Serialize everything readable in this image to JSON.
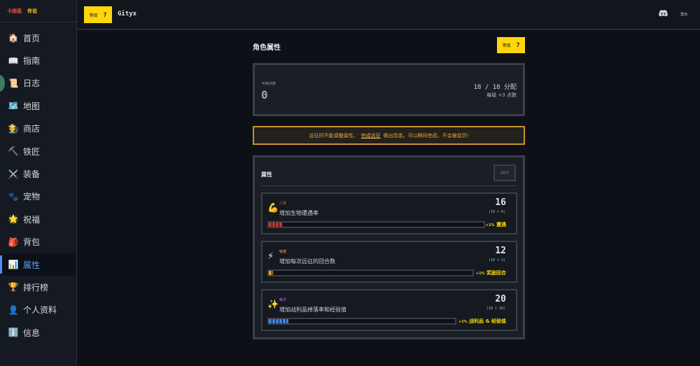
{
  "brand": {
    "name": "卡姆基",
    "tier": "传说"
  },
  "nav": [
    {
      "icon": "🏠",
      "label": "首页"
    },
    {
      "icon": "📖",
      "label": "指南"
    },
    {
      "icon": "📜",
      "label": "日志"
    },
    {
      "icon": "🗺️",
      "label": "地图"
    },
    {
      "icon": "🧑‍🌾",
      "label": "商店"
    },
    {
      "icon": "⛏️",
      "label": "铁匠"
    },
    {
      "icon": "⚔️",
      "label": "装备"
    },
    {
      "icon": "🐾",
      "label": "宠物"
    },
    {
      "icon": "🌟",
      "label": "祝福"
    },
    {
      "icon": "🎒",
      "label": "背包"
    },
    {
      "icon": "📊",
      "label": "属性"
    },
    {
      "icon": "🏆",
      "label": "排行榜"
    },
    {
      "icon": "👤",
      "label": "个人资料"
    },
    {
      "icon": "ℹ️",
      "label": "信息"
    }
  ],
  "topbar": {
    "level_label": "等级",
    "level_value": "7",
    "player_name": "Gityx",
    "logout_label": "登出"
  },
  "page": {
    "title": "角色属性",
    "level_label": "等级",
    "level_value": "7"
  },
  "points": {
    "label": "可用点数",
    "value": "0",
    "allocated": "18 / 18 分配",
    "per_level": "每级 +3 点数"
  },
  "warning": {
    "prefix": "远征时不能调整属性。",
    "link": "完成远征",
    "suffix": "做出改变。可以瞬间完成，不会被惩罚!"
  },
  "attributes": {
    "title": "属性",
    "button_label": "远征中",
    "items": [
      {
        "icon": "💪",
        "name": "力量",
        "name_color": "#e24a3b",
        "description": "增加生物遭遇率",
        "value": "16",
        "breakdown": "(10 + 6)",
        "bonus_pct": "+1%",
        "bonus_text": "遭遇",
        "bar_fill": 0.062,
        "bar_color": "#c0392b"
      },
      {
        "icon": "⚡",
        "name": "敏捷",
        "name_color": "#e9a73b",
        "description": "增加每次远征的回合数",
        "value": "12",
        "breakdown": "(10 + 2)",
        "bonus_pct": "+1%",
        "bonus_text": "奖励回合",
        "bar_fill": 0.021,
        "bar_color": "#e0a020"
      },
      {
        "icon": "✨",
        "name": "精灵",
        "name_color": "#b06ee8",
        "description": "增加战利品掉落率和经验值",
        "value": "20",
        "breakdown": "(10 + 10)",
        "bonus_pct": "+1%",
        "bonus_text": "战利品 & 经验值",
        "bar_fill": 0.104,
        "bar_color": "#3f86e0"
      }
    ]
  }
}
